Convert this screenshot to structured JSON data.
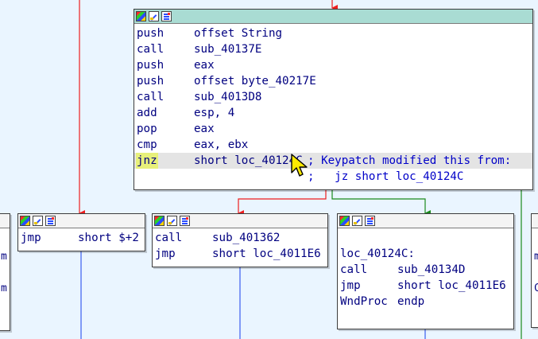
{
  "colors": {
    "background": "#eaf5ff",
    "edge_red": "#ee1f1f",
    "edge_green": "#1a8a1a",
    "edge_blue": "#3a5cf0",
    "mnemonic": "#000080",
    "comment": "#0000c8",
    "active_title": "#a9dcd3",
    "annotation_arrow": "#e23d3d",
    "cursor_fill": "#ffea00"
  },
  "icons": {
    "title_icons": [
      "node-color-icon",
      "rename-icon",
      "group-nodes-icon"
    ],
    "cursor": "mouse-pointer-icon",
    "annotation": "annotation-arrow-icon"
  },
  "main_block": {
    "lines": [
      {
        "mn": "push",
        "op": "offset String"
      },
      {
        "mn": "call",
        "op": "sub_40137E"
      },
      {
        "mn": "push",
        "op": "eax"
      },
      {
        "mn": "push",
        "op": "offset byte_40217E"
      },
      {
        "mn": "call",
        "op": "sub_4013D8"
      },
      {
        "mn": "add",
        "op": "esp, 4"
      },
      {
        "mn": "pop",
        "op": "eax"
      },
      {
        "mn": "cmp",
        "op": "eax, ebx"
      },
      {
        "mn": "jnz",
        "op": "short loc_40124C",
        "comment": "; Keypatch modified this from:"
      },
      {
        "mn": "",
        "op": "",
        "comment": ";   jz short loc_40124C"
      }
    ]
  },
  "block_jmp_self": {
    "lines": [
      {
        "mn": "jmp",
        "op": "short $+2"
      }
    ]
  },
  "block_call": {
    "lines": [
      {
        "mn": "call",
        "op": "sub_401362"
      },
      {
        "mn": "jmp",
        "op": "short loc_4011E6"
      }
    ]
  },
  "block_loc": {
    "label": "loc_40124C:",
    "lines": [
      {
        "mn": "call",
        "op": "sub_40134D"
      },
      {
        "mn": "jmp",
        "op": "short loc_4011E6"
      },
      {
        "mn": "WndProc",
        "op": "endp"
      }
    ]
  },
  "left_partial": {
    "lines": [
      "m",
      "m"
    ]
  },
  "right_partial": {
    "lines": [
      "m",
      "C"
    ]
  }
}
